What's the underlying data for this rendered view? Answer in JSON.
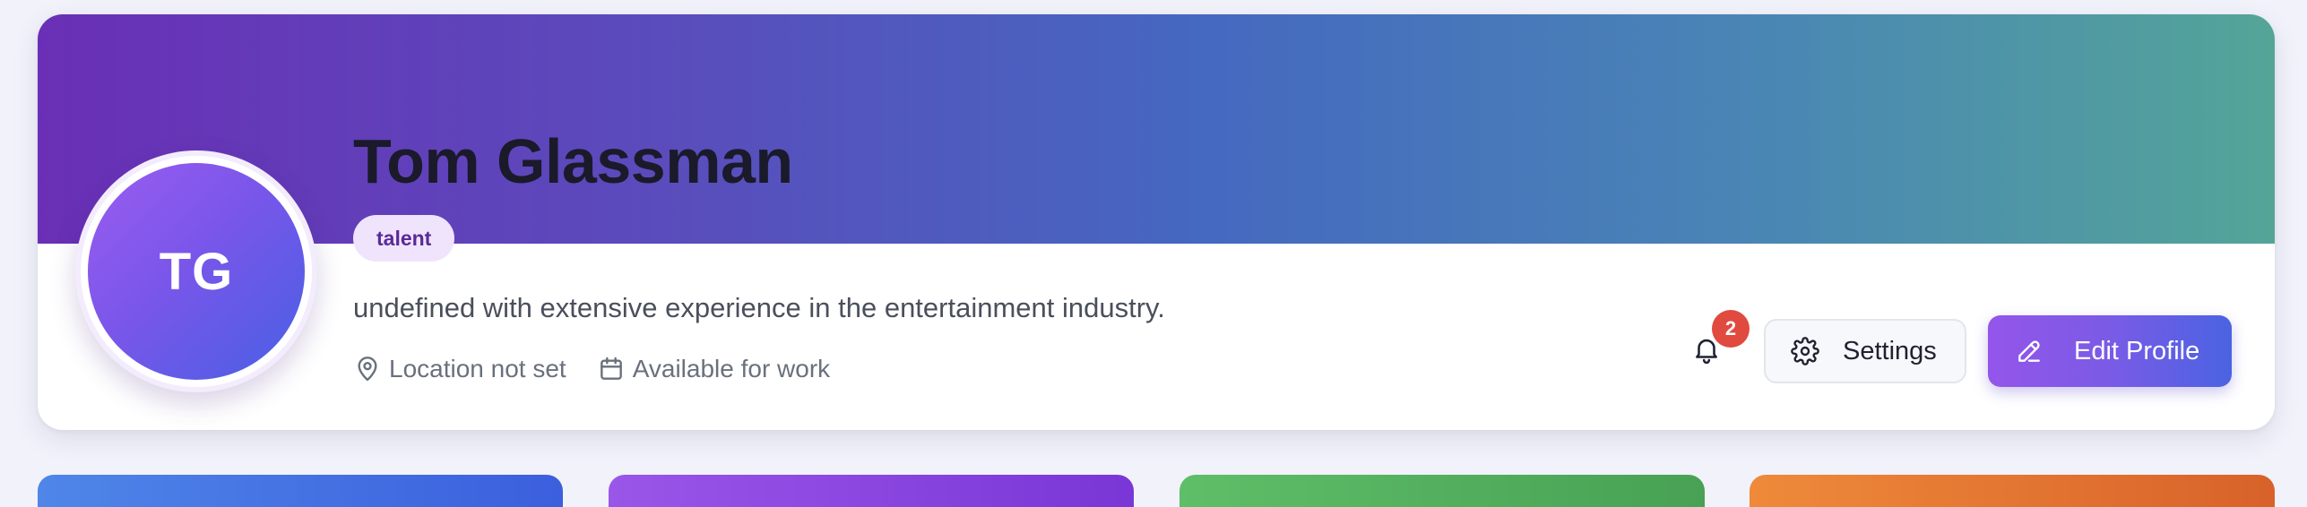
{
  "profile": {
    "name": "Tom Glassman",
    "initials": "TG",
    "role": "talent",
    "bio": "undefined with extensive experience in the entertainment industry.",
    "location": "Location not set",
    "availability": "Available for work",
    "location_icon": "map-pin-icon",
    "availability_icon": "calendar-icon"
  },
  "actions": {
    "notifications_icon": "bell-icon",
    "notifications_count": "2",
    "settings_label": "Settings",
    "settings_icon": "gear-icon",
    "edit_label": "Edit Profile",
    "edit_icon": "pencil-icon"
  },
  "colors": {
    "banner_gradient": [
      "#6a2fb6",
      "#4568c0",
      "#54a598"
    ],
    "role_badge_bg": "#efe4fb",
    "role_badge_text": "#5b2a98",
    "notification_badge": "#e04a3f",
    "edit_button_gradient": [
      "#9455ea",
      "#4a63e2"
    ],
    "stat_cards": [
      "#4f86e8",
      "#9a56e8",
      "#5fbe68",
      "#ee8a3a"
    ]
  }
}
